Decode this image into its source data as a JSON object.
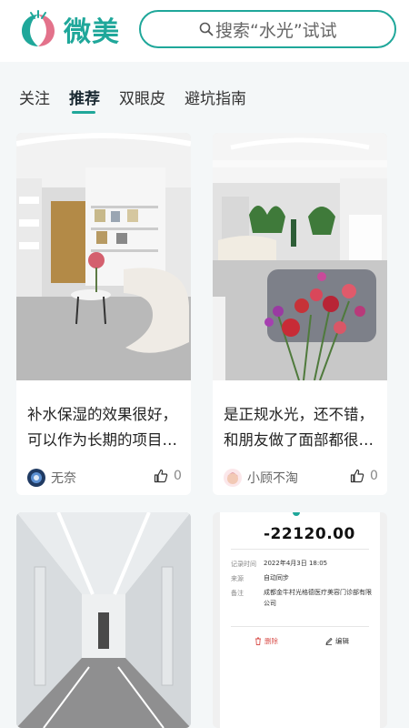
{
  "brand": {
    "name": "微美",
    "accent": "#1fa79a",
    "logo_pink": "#e3728b"
  },
  "search": {
    "placeholder": "搜索“水光”试试"
  },
  "tabs": [
    "关注",
    "推荐",
    "双眼皮",
    "避坑指南"
  ],
  "active_tab": "推荐",
  "posts": [
    {
      "title_line1": "补水保湿的效果很好，",
      "title_line2": "可以作为长期的项目…",
      "author": "无奈",
      "likes": "0",
      "image": "clinic-lounge-photo"
    },
    {
      "title_line1": "是正规水光，还不错，",
      "title_line2": "和朋友做了面部都很…",
      "author": "小顾不淘",
      "likes": "0",
      "image": "clinic-flowers-photo"
    },
    {
      "image": "clinic-corridor-photo"
    },
    {
      "image": "payment-receipt-screenshot",
      "receipt": {
        "amount": "-22120.00",
        "time_label": "记录时间",
        "time_value": "2022年4月3日 18:05",
        "source_label": "来源",
        "source_value": "自动同步",
        "note_label": "备注",
        "note_value": "成都金牛村光格德医疗美容门诊部有限公司",
        "delete_label": "删除",
        "edit_label": "编辑"
      }
    }
  ]
}
